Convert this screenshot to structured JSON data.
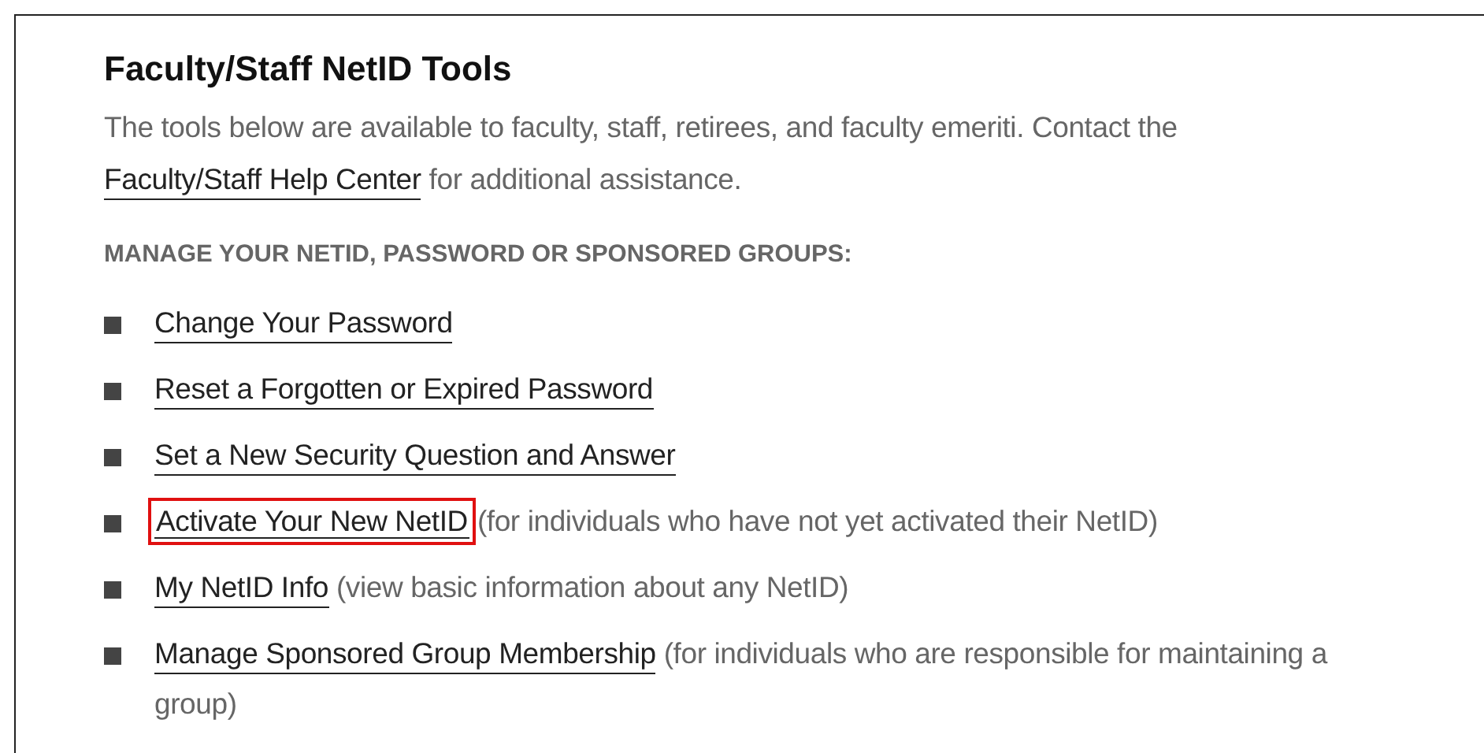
{
  "title": "Faculty/Staff NetID Tools",
  "intro": {
    "text_before": "The tools below are available to faculty, staff, retirees, and faculty emeriti. Contact the",
    "link": "Faculty/Staff Help Center",
    "text_after": "for additional assistance."
  },
  "section_heading": "MANAGE YOUR NETID, PASSWORD OR SPONSORED GROUPS:",
  "links": [
    {
      "label": "Change Your Password",
      "highlighted": false
    },
    {
      "label": "Reset a Forgotten or Expired Password",
      "highlighted": false
    },
    {
      "label": "Set a New Security Question and Answer",
      "highlighted": false
    },
    {
      "label": "Activate Your New NetID",
      "note": "(for individuals who have not yet activated their NetID)",
      "highlighted": true
    },
    {
      "label": "My NetID Info",
      "note": "(view basic information about any NetID)",
      "highlighted": false
    },
    {
      "label": "Manage Sponsored Group Membership",
      "note": "(for individuals who are responsible for maintaining a group)",
      "highlighted": false
    }
  ]
}
